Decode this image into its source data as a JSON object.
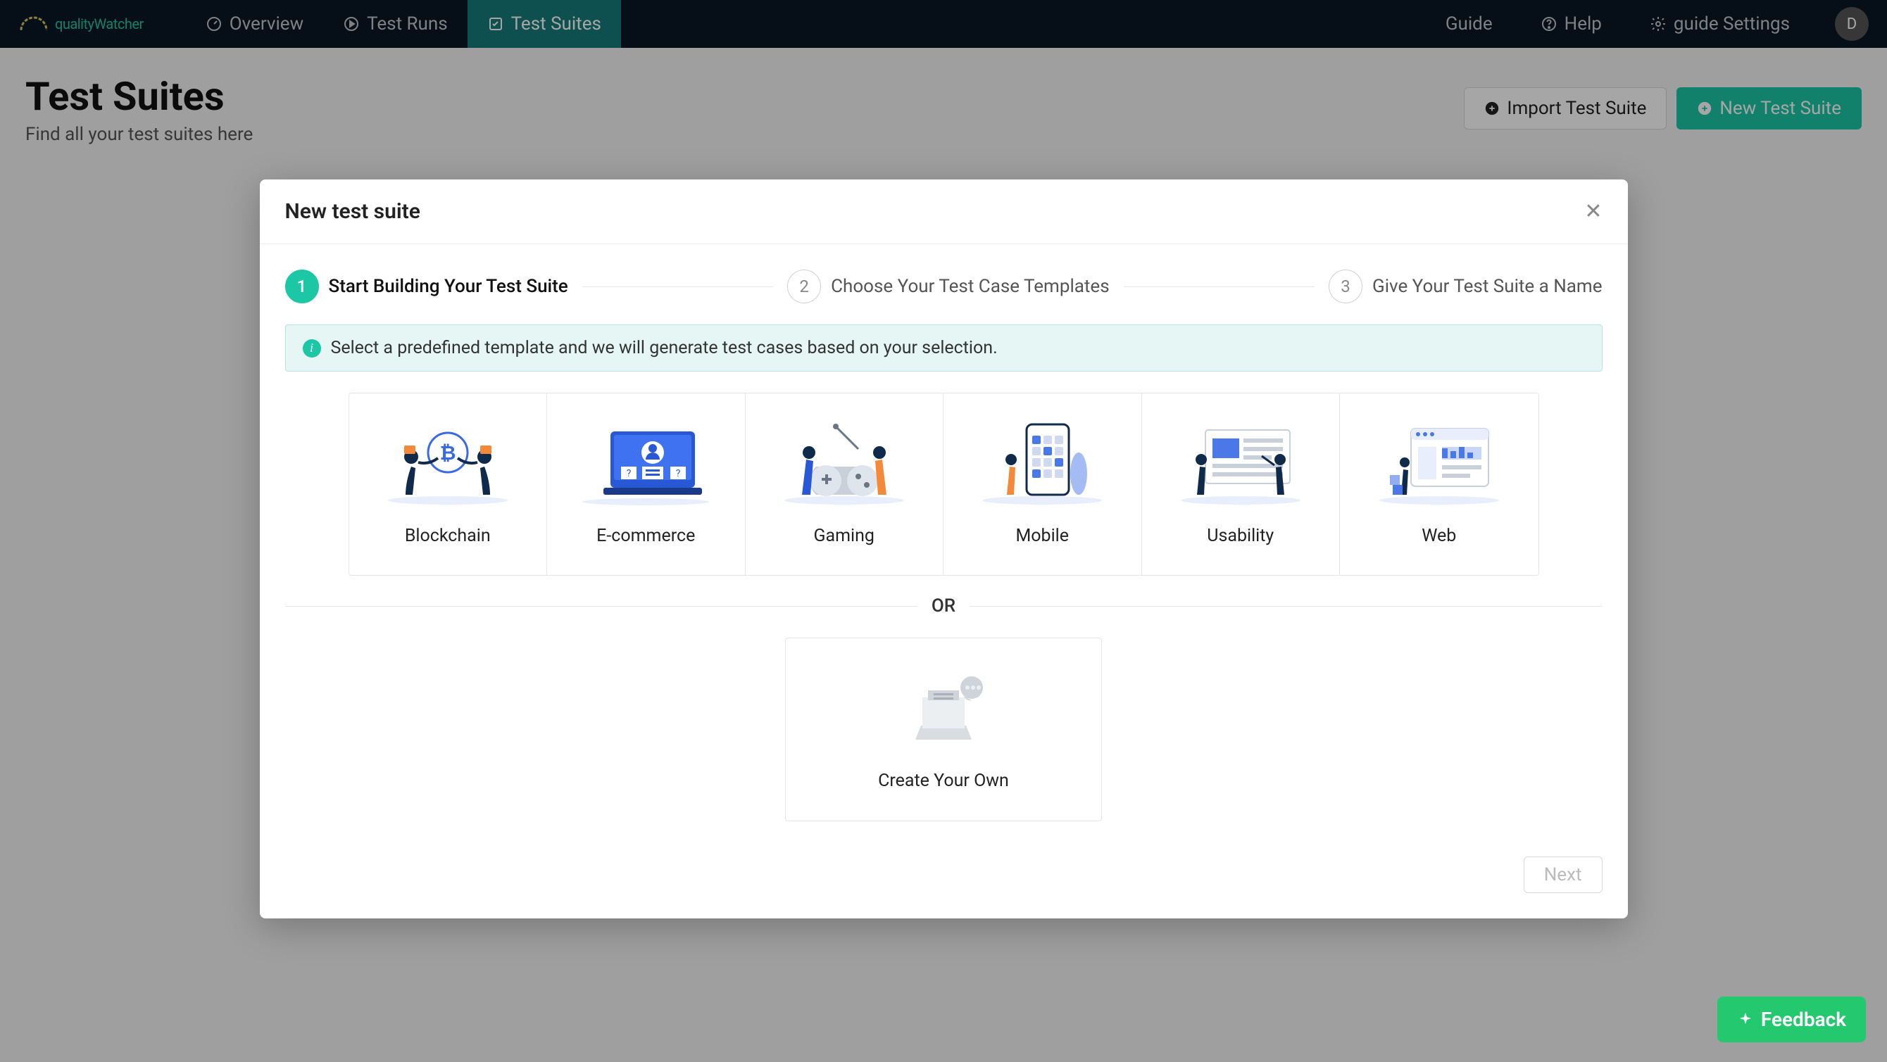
{
  "brand": "qualityWatcher",
  "nav": {
    "overview": "Overview",
    "test_runs": "Test Runs",
    "test_suites": "Test Suites",
    "guide": "Guide",
    "help": "Help",
    "settings": "guide Settings",
    "avatar_letter": "D"
  },
  "page": {
    "title": "Test Suites",
    "subtitle": "Find all your test suites here",
    "import_btn": "Import Test Suite",
    "new_btn": "New Test Suite"
  },
  "modal": {
    "title": "New test suite",
    "steps": [
      {
        "num": "1",
        "label": "Start Building Your Test Suite"
      },
      {
        "num": "2",
        "label": "Choose Your Test Case Templates"
      },
      {
        "num": "3",
        "label": "Give Your Test Suite a Name"
      }
    ],
    "info_text": "Select a predefined template and we will generate test cases based on your selection.",
    "templates": [
      {
        "label": "Blockchain",
        "icon": "blockchain"
      },
      {
        "label": "E-commerce",
        "icon": "ecommerce"
      },
      {
        "label": "Gaming",
        "icon": "gaming"
      },
      {
        "label": "Mobile",
        "icon": "mobile"
      },
      {
        "label": "Usability",
        "icon": "usability"
      },
      {
        "label": "Web",
        "icon": "web"
      }
    ],
    "or_label": "OR",
    "own_label": "Create Your Own",
    "next_btn": "Next"
  },
  "feedback": "Feedback"
}
